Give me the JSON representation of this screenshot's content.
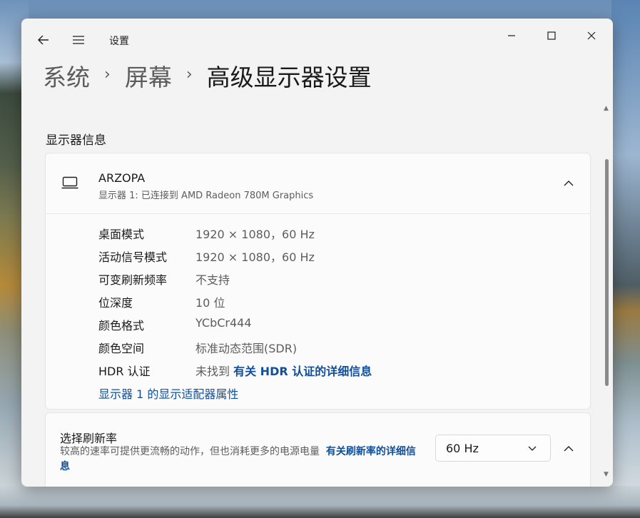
{
  "window": {
    "title": "设置",
    "minimize_glyph": "—",
    "maximize_glyph": "☐",
    "close_glyph": "✕"
  },
  "breadcrumb": {
    "items": [
      "系统",
      "屏幕"
    ],
    "separator": "›",
    "current": "高级显示器设置"
  },
  "section": {
    "title": "显示器信息"
  },
  "display": {
    "name": "ARZOPA",
    "subtitle": "显示器 1: 已连接到 AMD Radeon 780M Graphics",
    "icon": "laptop-icon",
    "rows": [
      {
        "label": "桌面模式",
        "value": "1920 × 1080，60 Hz"
      },
      {
        "label": "活动信号模式",
        "value": "1920 × 1080，60 Hz"
      },
      {
        "label": "可变刷新频率",
        "value": "不支持"
      },
      {
        "label": "位深度",
        "value": "10 位"
      },
      {
        "label": "颜色格式",
        "value": "YCbCr444"
      },
      {
        "label": "颜色空间",
        "value": "标准动态范围(SDR)"
      }
    ],
    "hdr": {
      "label": "HDR 认证",
      "value_prefix": "未找到",
      "link": "有关 HDR 认证的详细信息"
    },
    "adapter_link": "显示器 1 的显示适配器属性"
  },
  "refresh_rate": {
    "title": "选择刷新率",
    "description": "较高的速率可提供更流畅的动作，但也消耗更多的电源电量",
    "link": "有关刷新率的详细信息",
    "selected": "60 Hz"
  },
  "colors": {
    "link": "#0f4f9c",
    "window_bg": "#f3f3f3",
    "card_bg": "#fbfbfb"
  }
}
